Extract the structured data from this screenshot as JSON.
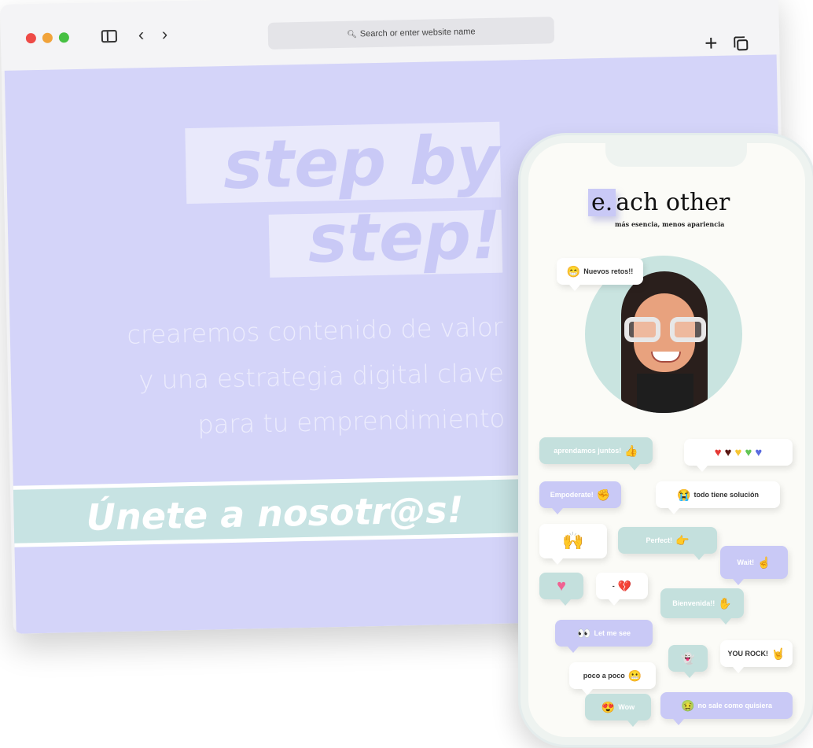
{
  "browser": {
    "address_placeholder": "Search or enter website name"
  },
  "page": {
    "headline_line1": "step by",
    "headline_line2": "step!",
    "subtext_line1": "crearemos contenido de valor",
    "subtext_line2": "y una estrategia digital clave",
    "subtext_line3": "para tu emprendimiento",
    "cta": "Únete a nosotr@s!"
  },
  "phone": {
    "logo_initial": "e.",
    "logo_rest": "ach other",
    "tagline": "más esencia, menos apariencia",
    "bubbles": {
      "nuevos_retos": "Nuevos retos!!",
      "aprendamos": "aprendamos juntos!",
      "empoderate": "Empoderate!",
      "todo_tiene": "todo tiene solución",
      "perfect": "Perfect!",
      "wait": "Wait!",
      "dash": "- ",
      "bienvenida": "Bienvenida!!",
      "let_me_see": "Let me see",
      "you_rock": "YOU ROCK!",
      "poco_a_poco": "poco a poco",
      "wow": "Wow",
      "no_sale": "no sale como quisiera"
    }
  },
  "colors": {
    "lavender": "#d4d4f9",
    "lavender_dark": "#c9c9f6",
    "teal": "#c4e0dd",
    "phone_bg": "#fbfbf7"
  }
}
